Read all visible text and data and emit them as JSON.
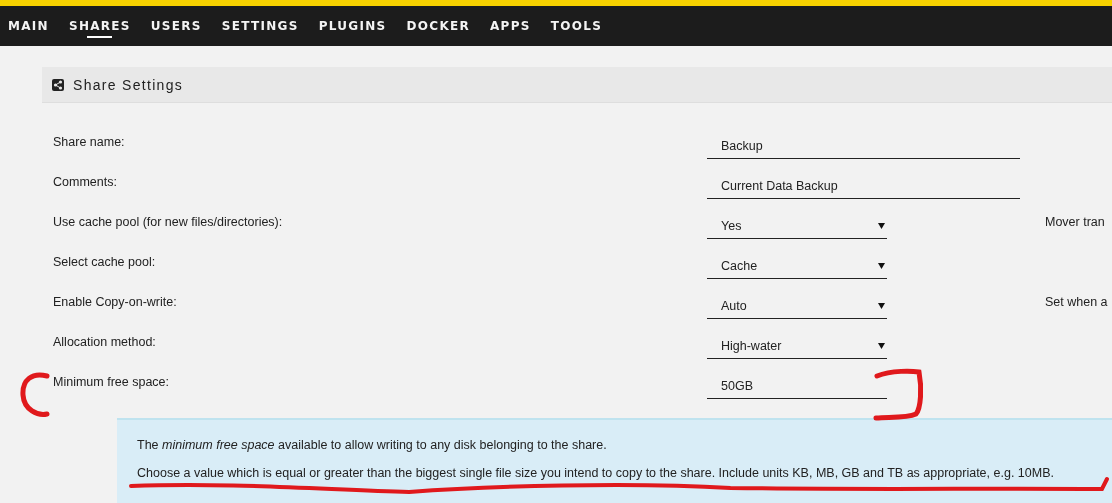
{
  "nav": {
    "tabs": [
      {
        "label": "MAIN",
        "selected": false
      },
      {
        "label": "SHARES",
        "selected": true
      },
      {
        "label": "USERS",
        "selected": false
      },
      {
        "label": "SETTINGS",
        "selected": false
      },
      {
        "label": "PLUGINS",
        "selected": false
      },
      {
        "label": "DOCKER",
        "selected": false
      },
      {
        "label": "APPS",
        "selected": false
      },
      {
        "label": "TOOLS",
        "selected": false
      }
    ]
  },
  "section": {
    "title": "Share Settings"
  },
  "settings": [
    {
      "label": "Share name:",
      "kind": "text",
      "value": "Backup"
    },
    {
      "label": "Comments:",
      "kind": "text",
      "value": "Current Data Backup"
    },
    {
      "label": "Use cache pool (for new files/directories):",
      "kind": "select",
      "value": "Yes",
      "note": "Mover tran"
    },
    {
      "label": "Select cache pool:",
      "kind": "select",
      "value": "Cache"
    },
    {
      "label": "Enable Copy-on-write:",
      "kind": "select",
      "value": "Auto",
      "note": "Set when a"
    },
    {
      "label": "Allocation method:",
      "kind": "select",
      "value": "High-water"
    },
    {
      "label": "Minimum free space:",
      "kind": "short",
      "value": "50GB"
    }
  ],
  "help": {
    "paragraphs": [
      "The *minimum free space* available to allow writing to any disk belonging to the share.",
      "Choose a value which is equal or greater than the biggest single file size you intend to copy to the share. Include units KB, MB, GB and TB as appropriate, e.g. 10MB."
    ]
  }
}
